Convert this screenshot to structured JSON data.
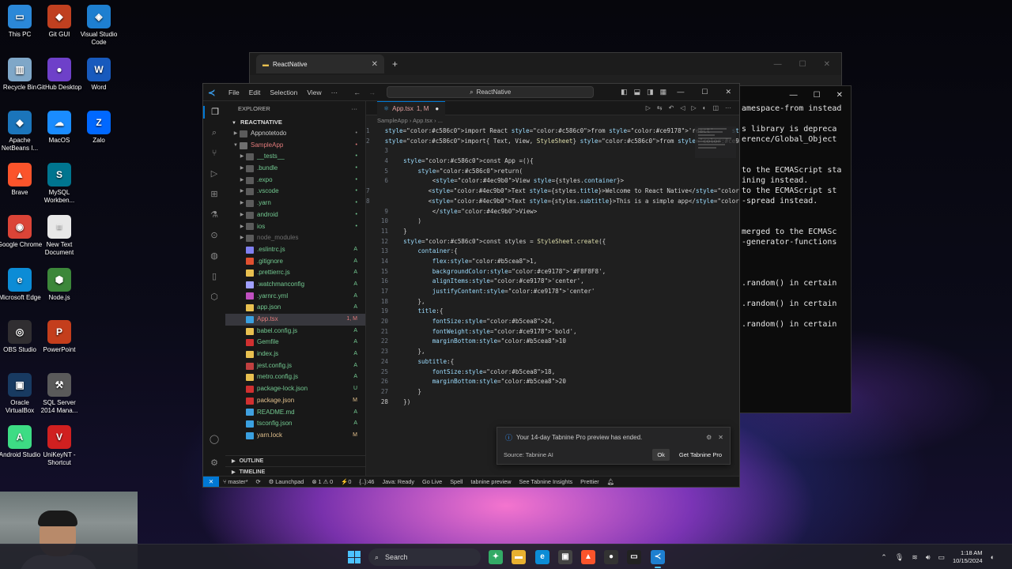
{
  "desktop": {
    "icons": [
      {
        "label": "This PC",
        "glyph": "▭",
        "color": "#2b88d8"
      },
      {
        "label": "Git GUI",
        "glyph": "◆",
        "color": "#c04020"
      },
      {
        "label": "Visual Studio Code",
        "glyph": "◈",
        "color": "#1e7fd0"
      },
      {
        "label": "Recycle Bin",
        "glyph": "▥",
        "color": "#7fa7c8"
      },
      {
        "label": "GitHub Desktop",
        "glyph": "●",
        "color": "#6e40c9"
      },
      {
        "label": "Word",
        "glyph": "W",
        "color": "#185abd"
      },
      {
        "label": "Apache NetBeans I...",
        "glyph": "◆",
        "color": "#1b75bb"
      },
      {
        "label": "MacOS",
        "glyph": "☁",
        "color": "#1a8cff"
      },
      {
        "label": "Zalo",
        "glyph": "Z",
        "color": "#0068ff"
      },
      {
        "label": "Brave",
        "glyph": "▲",
        "color": "#fb542b"
      },
      {
        "label": "MySQL Workben...",
        "glyph": "S",
        "color": "#00758f"
      },
      {
        "label": "Google Chrome",
        "glyph": "◉",
        "color": "#db4437"
      },
      {
        "label": "New Text Document",
        "glyph": "≡",
        "color": "#e8e8e8"
      },
      {
        "label": "Microsoft Edge",
        "glyph": "e",
        "color": "#0c8cd6"
      },
      {
        "label": "Node.js",
        "glyph": "⬢",
        "color": "#3c873a"
      },
      {
        "label": "OBS Studio",
        "glyph": "◎",
        "color": "#302e31"
      },
      {
        "label": "PowerPoint",
        "glyph": "P",
        "color": "#c43e1c"
      },
      {
        "label": "Oracle VirtualBox",
        "glyph": "▣",
        "color": "#183a61"
      },
      {
        "label": "SQL Server 2014 Mana...",
        "glyph": "⚒",
        "color": "#5a5a5a"
      },
      {
        "label": "Android Studio",
        "glyph": "A",
        "color": "#3ddc84"
      },
      {
        "label": "UniKeyNT - Shortcut",
        "glyph": "V",
        "color": "#d02020"
      }
    ]
  },
  "back_window": {
    "tab_title": "ReactNative",
    "tab_close": "✕",
    "new_tab": "+"
  },
  "terminal": {
    "lines": [
      "amespace-from instead",
      "",
      "s library is depreca",
      "erence/Global_Object",
      "",
      "",
      "to the ECMAScript sta",
      "ining instead.",
      "to the ECMAScript st",
      "-spread instead.",
      "",
      "",
      "merged to the ECMASc",
      "-generator-functions",
      "",
      "",
      "",
      ".random() in certain",
      "",
      ".random() in certain",
      "",
      ".random() in certain"
    ]
  },
  "vscode": {
    "menu": [
      "File",
      "Edit",
      "Selection",
      "View",
      "···"
    ],
    "command_center": "ReactNative",
    "explorer_title": "EXPLORER",
    "explorer_more": "···",
    "root_folder": "REACTNATIVE",
    "tree": [
      {
        "name": "Appnotetodo",
        "kind": "folder",
        "indent": 1,
        "chev": "▶",
        "badge": "•",
        "color": "#cccccc",
        "badge_color": "#8a8a8a"
      },
      {
        "name": "SampleApp",
        "kind": "folder-open",
        "indent": 1,
        "chev": "▼",
        "badge": "•",
        "color": "#e07a7a",
        "badge_color": "#e07a7a"
      },
      {
        "name": "__tests__",
        "kind": "folder",
        "indent": 2,
        "chev": "▶",
        "badge": "•",
        "color": "#73c991",
        "badge_color": "#73c991"
      },
      {
        "name": ".bundle",
        "kind": "folder",
        "indent": 2,
        "chev": "▶",
        "badge": "•",
        "color": "#73c991",
        "badge_color": "#73c991"
      },
      {
        "name": ".expo",
        "kind": "folder",
        "indent": 2,
        "chev": "▶",
        "badge": "•",
        "color": "#73c991",
        "badge_color": "#73c991"
      },
      {
        "name": ".vscode",
        "kind": "folder",
        "indent": 2,
        "chev": "▶",
        "badge": "•",
        "color": "#73c991",
        "badge_color": "#73c991"
      },
      {
        "name": ".yarn",
        "kind": "folder",
        "indent": 2,
        "chev": "▶",
        "badge": "•",
        "color": "#73c991",
        "badge_color": "#73c991"
      },
      {
        "name": "android",
        "kind": "folder",
        "indent": 2,
        "chev": "▶",
        "badge": "•",
        "color": "#73c991",
        "badge_color": "#73c991"
      },
      {
        "name": "ios",
        "kind": "folder",
        "indent": 2,
        "chev": "▶",
        "badge": "•",
        "color": "#73c991",
        "badge_color": "#73c991"
      },
      {
        "name": "node_modules",
        "kind": "folder",
        "indent": 2,
        "chev": "▶",
        "badge": "",
        "color": "#6e6e6e",
        "badge_color": "#6e6e6e"
      },
      {
        "name": ".eslintrc.js",
        "kind": "file",
        "indent": 2,
        "chev": "",
        "badge": "A",
        "color": "#73c991",
        "badge_color": "#73c991",
        "icon_color": "#8080f0"
      },
      {
        "name": ".gitignore",
        "kind": "file",
        "indent": 2,
        "chev": "",
        "badge": "A",
        "color": "#73c991",
        "badge_color": "#73c991",
        "icon_color": "#e05030"
      },
      {
        "name": ".prettierrc.js",
        "kind": "file",
        "indent": 2,
        "chev": "",
        "badge": "A",
        "color": "#73c991",
        "badge_color": "#73c991",
        "icon_color": "#e8c050"
      },
      {
        "name": ".watchmanconfig",
        "kind": "file",
        "indent": 2,
        "chev": "",
        "badge": "A",
        "color": "#73c991",
        "badge_color": "#73c991",
        "icon_color": "#a0a0ff"
      },
      {
        "name": ".yarnrc.yml",
        "kind": "file",
        "indent": 2,
        "chev": "",
        "badge": "A",
        "color": "#73c991",
        "badge_color": "#73c991",
        "icon_color": "#c050c0"
      },
      {
        "name": "app.json",
        "kind": "file",
        "indent": 2,
        "chev": "",
        "badge": "A",
        "color": "#73c991",
        "badge_color": "#73c991",
        "icon_color": "#e8c050"
      },
      {
        "name": "App.tsx",
        "kind": "file",
        "indent": 2,
        "chev": "",
        "badge": "1, M",
        "color": "#e07a7a",
        "badge_color": "#e07a7a",
        "icon_color": "#3aa0e0",
        "selected": true
      },
      {
        "name": "babel.config.js",
        "kind": "file",
        "indent": 2,
        "chev": "",
        "badge": "A",
        "color": "#73c991",
        "badge_color": "#73c991",
        "icon_color": "#e8c050"
      },
      {
        "name": "Gemfile",
        "kind": "file",
        "indent": 2,
        "chev": "",
        "badge": "A",
        "color": "#73c991",
        "badge_color": "#73c991",
        "icon_color": "#d03030"
      },
      {
        "name": "index.js",
        "kind": "file",
        "indent": 2,
        "chev": "",
        "badge": "A",
        "color": "#73c991",
        "badge_color": "#73c991",
        "icon_color": "#e8c050"
      },
      {
        "name": "jest.config.js",
        "kind": "file",
        "indent": 2,
        "chev": "",
        "badge": "A",
        "color": "#73c991",
        "badge_color": "#73c991",
        "icon_color": "#c04040"
      },
      {
        "name": "metro.config.js",
        "kind": "file",
        "indent": 2,
        "chev": "",
        "badge": "A",
        "color": "#73c991",
        "badge_color": "#73c991",
        "icon_color": "#e8c050"
      },
      {
        "name": "package-lock.json",
        "kind": "file",
        "indent": 2,
        "chev": "",
        "badge": "U",
        "color": "#73c991",
        "badge_color": "#73c991",
        "icon_color": "#d03030"
      },
      {
        "name": "package.json",
        "kind": "file",
        "indent": 2,
        "chev": "",
        "badge": "M",
        "color": "#e2c08d",
        "badge_color": "#e2c08d",
        "icon_color": "#d03030"
      },
      {
        "name": "README.md",
        "kind": "file",
        "indent": 2,
        "chev": "",
        "badge": "A",
        "color": "#73c991",
        "badge_color": "#73c991",
        "icon_color": "#40a0e0"
      },
      {
        "name": "tsconfig.json",
        "kind": "file",
        "indent": 2,
        "chev": "",
        "badge": "A",
        "color": "#73c991",
        "badge_color": "#73c991",
        "icon_color": "#3aa0e0"
      },
      {
        "name": "yarn.lock",
        "kind": "file",
        "indent": 2,
        "chev": "",
        "badge": "M",
        "color": "#e2c08d",
        "badge_color": "#e2c08d",
        "icon_color": "#3aa0e0"
      }
    ],
    "outline_label": "OUTLINE",
    "timeline_label": "TIMELINE",
    "active_tab": "App.tsx",
    "active_tab_suffix": "1, M",
    "breadcrumb": "SampleApp  ›  App.tsx  ›  ...",
    "code_lines": [
      {
        "n": "1",
        "t": "  import React from 'react'     6.9k (gzipped: 2.7k)"
      },
      {
        "n": "2",
        "t": "  import{ Text, View, StyleSheet} from 'react-native'"
      },
      {
        "n": "3",
        "t": ""
      },
      {
        "n": "4",
        "t": "  const App =(){"
      },
      {
        "n": "5",
        "t": "      return("
      },
      {
        "n": "6",
        "t": "          <View style={styles.container}>"
      },
      {
        "n": "7",
        "t": "              <Text style={styles.title}>Welcome to React Native</Text"
      },
      {
        "n": "8",
        "t": "              <Text style={styles.subtitle}>This is a simple app</Text"
      },
      {
        "n": "9",
        "t": "          </View>"
      },
      {
        "n": "10",
        "t": "      )"
      },
      {
        "n": "11",
        "t": "  }"
      },
      {
        "n": "12",
        "t": "  const styles = StyleSheet.create({"
      },
      {
        "n": "13",
        "t": "      container:{"
      },
      {
        "n": "14",
        "t": "          flex:1,"
      },
      {
        "n": "15",
        "t": "          backgroundColor:'#F8F8F8',"
      },
      {
        "n": "16",
        "t": "          alignItems:'center',"
      },
      {
        "n": "17",
        "t": "          justifyContent:'center'"
      },
      {
        "n": "18",
        "t": "      },"
      },
      {
        "n": "19",
        "t": "      title:{"
      },
      {
        "n": "20",
        "t": "          fontSize:24,"
      },
      {
        "n": "21",
        "t": "          fontWeight:'bold',"
      },
      {
        "n": "22",
        "t": "          marginBottom:10"
      },
      {
        "n": "23",
        "t": "      },"
      },
      {
        "n": "24",
        "t": "      subtitle:{"
      },
      {
        "n": "25",
        "t": "          fontSize:18,"
      },
      {
        "n": "26",
        "t": "          marginBottom:20"
      },
      {
        "n": "27",
        "t": "      }"
      },
      {
        "n": "28",
        "t": "  })"
      }
    ],
    "notification": {
      "message": "Your 14-day Tabnine Pro preview has ended.",
      "source": "Source: Tabnine AI",
      "ok": "Ok",
      "get_pro": "Get Tabnine Pro"
    },
    "status": {
      "branch": "master*",
      "launchpad": "Launchpad",
      "problems": "⊗ 1 ⚠ 0",
      "ports": "⚡0",
      "cursor": "{..}:46",
      "java": "Java: Ready",
      "golive": "Go Live",
      "spell": "Spell",
      "tabnine": "tabnine preview",
      "insights": "See Tabnine Insights",
      "prettier": "Prettier"
    }
  },
  "taskbar": {
    "search_label": "Search",
    "time": "1:18 AM",
    "date": "10/15/2024"
  }
}
